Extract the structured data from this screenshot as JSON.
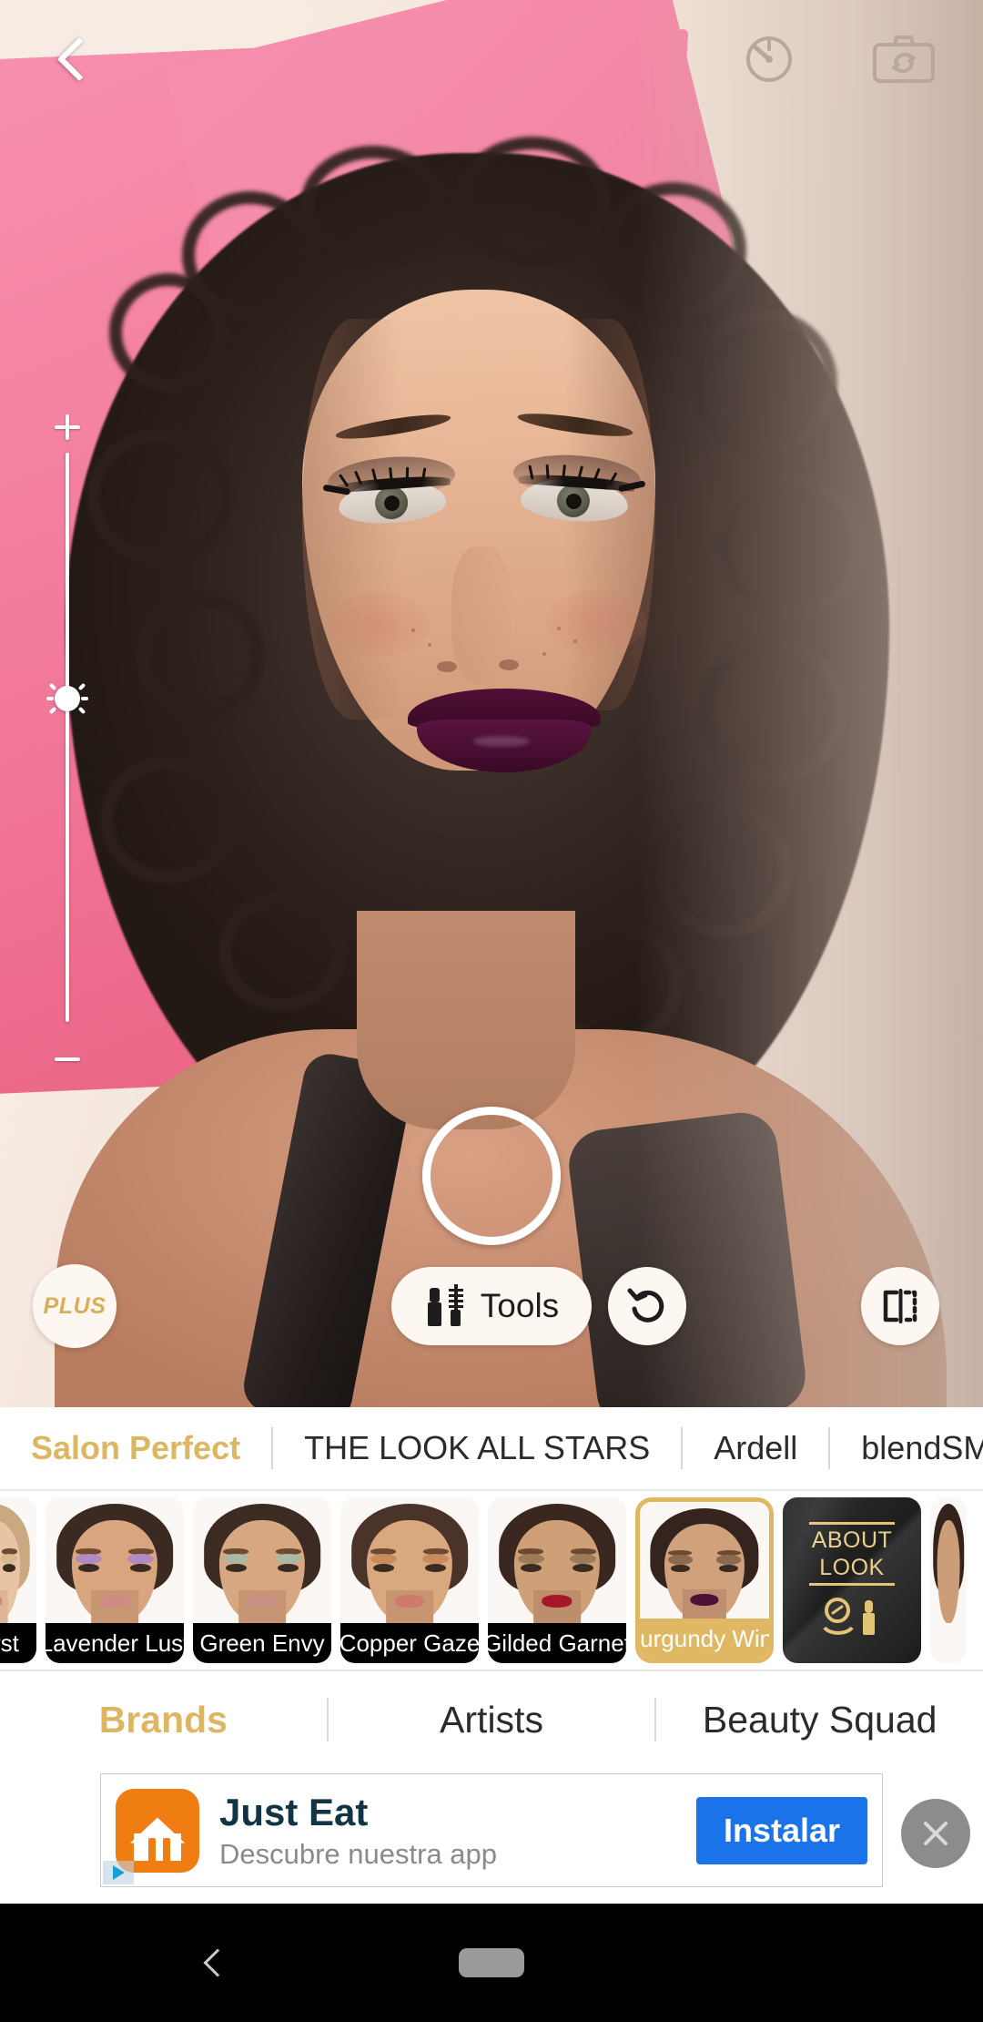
{
  "app": {
    "accent_gold": "#ddb662",
    "cta_blue": "#1a73e8"
  },
  "topbar": {
    "back_label": "Back",
    "timer_icon": "timer-icon",
    "flip_camera_icon": "camera-flip-icon"
  },
  "brightness": {
    "increase_label": "+",
    "decrease_label": "−",
    "thumb_icon": "sun-icon",
    "value_percent": 50
  },
  "shutter": {
    "label": "Capture"
  },
  "camera_toolbar": {
    "plus_label": "PLUS",
    "tools_label": "Tools",
    "tools_icon": "lipstick-mascara-icon",
    "undo_icon": "undo-icon",
    "compare_icon": "compare-split-icon"
  },
  "brand_tabs": {
    "active_index": 0,
    "items": [
      {
        "label": "Salon Perfect"
      },
      {
        "label": "THE LOOK ALL STARS"
      },
      {
        "label": "Ardell"
      },
      {
        "label": "blendSMA"
      }
    ]
  },
  "looks": {
    "selected_index": 5,
    "items": [
      {
        "label": "burst",
        "skin": "#e8c3a4",
        "hair": "#c9a882",
        "lip": "#cf8a7e",
        "shadow": "#d8b98f",
        "partial": true
      },
      {
        "label": "Lavender Lust",
        "skin": "#d8a57f",
        "hair": "#3a2a22",
        "lip": "#d08a84",
        "shadow": "#b08ac0",
        "partial": false
      },
      {
        "label": "Green Envy",
        "skin": "#d7a781",
        "hair": "#3b2b23",
        "lip": "#c98f84",
        "shadow": "#a9b9a4",
        "partial": false
      },
      {
        "label": "Copper Gaze",
        "skin": "#d9a87f",
        "hair": "#4a3328",
        "lip": "#cf7a6c",
        "shadow": "#c98a5c",
        "partial": false
      },
      {
        "label": "Gilded Garnet",
        "skin": "#cf9f78",
        "hair": "#3a2820",
        "lip": "#a8162a",
        "shadow": "#9d7a58",
        "partial": false
      },
      {
        "label": "Burgundy Wink",
        "skin": "#cfa17c",
        "hair": "#34241d",
        "lip": "#4d1138",
        "shadow": "#8d6a4e",
        "partial": false
      }
    ],
    "about_look": {
      "line1": "ABOUT",
      "line2": "LOOK",
      "icon": "compact-lipstick-icon"
    }
  },
  "category_tabs": {
    "active_index": 0,
    "items": [
      {
        "label": "Brands"
      },
      {
        "label": "Artists"
      },
      {
        "label": "Beauty Squad"
      }
    ]
  },
  "ad": {
    "title": "Just Eat",
    "subtitle": "Descubre nuestra app",
    "cta_label": "Instalar",
    "close_label": "✕",
    "app_icon": "just-eat-icon",
    "ad_choices_icon": "ad-choices-icon"
  },
  "navbar": {
    "back_icon": "android-back-icon",
    "home_icon": "android-home-pill-icon"
  }
}
